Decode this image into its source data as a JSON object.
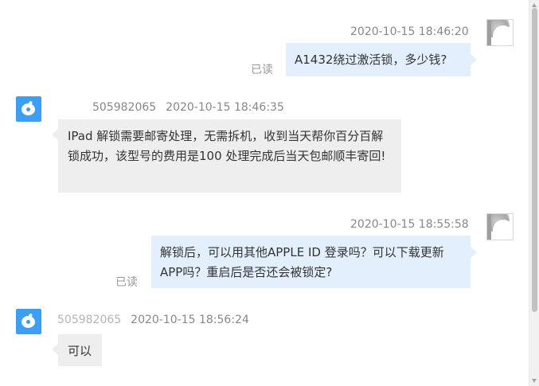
{
  "messages": [
    {
      "direction": "outgoing",
      "timestamp": "2020-10-15 18:46:20",
      "text": "A1432绕过激活锁，多少钱?",
      "read_status": "已读"
    },
    {
      "direction": "incoming",
      "sender": "505982065",
      "timestamp": "2020-10-15 18:46:35",
      "text": "IPad 解锁需要邮寄处理，无需拆机，收到当天帮你百分百解锁成功，该型号的费用是100 处理完成后当天包邮顺丰寄回!"
    },
    {
      "direction": "outgoing",
      "timestamp": "2020-10-15 18:55:58",
      "text": "解锁后，可以用其他APPLE ID 登录吗？可以下载更新APP吗？重启后是否还会被锁定?",
      "read_status": "已读"
    },
    {
      "direction": "incoming",
      "sender": "505982065",
      "timestamp": "2020-10-15 18:56:24",
      "text": "可以"
    }
  ],
  "icons": {
    "user_avatar": "user-avatar-icon",
    "agent_avatar": "chat-agent-icon"
  },
  "colors": {
    "outgoing_bubble": "#e3effd",
    "incoming_bubble": "#eeeeee",
    "agent_avatar": "#3d9ef5"
  }
}
